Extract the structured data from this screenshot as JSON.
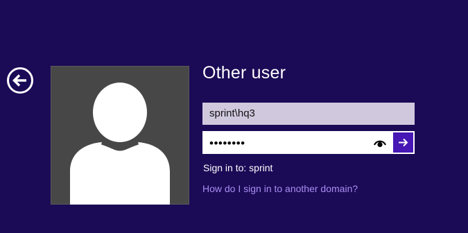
{
  "colors": {
    "background": "#1b0a56",
    "avatar_bg": "#474747",
    "username_bg": "#d0c9de",
    "submit_bg": "#4617b4",
    "link": "#a88ef2",
    "text": "#ffffff"
  },
  "icons": {
    "back": "back-arrow-circle-icon",
    "avatar": "user-silhouette-icon",
    "reveal": "eye-icon",
    "submit": "arrow-right-icon"
  },
  "login": {
    "title": "Other user",
    "username": "sprint\\hq3",
    "password_masked": "••••••••",
    "sign_in_to": "Sign in to: sprint",
    "help_link": "How do I sign in to another domain?"
  }
}
